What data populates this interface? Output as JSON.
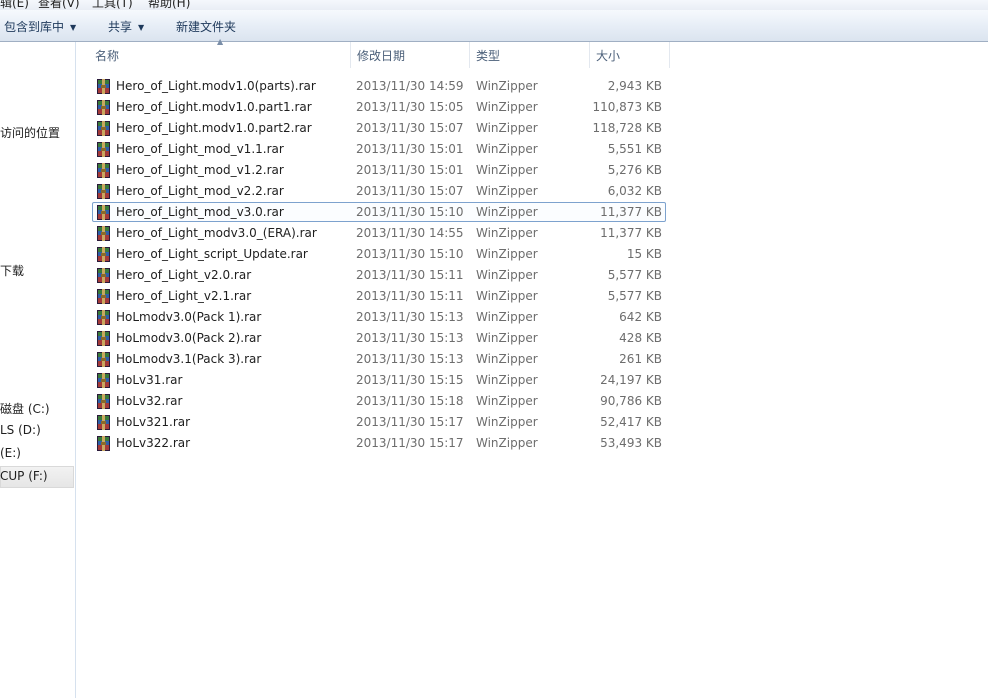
{
  "menubar": {
    "items": [
      "辑(E)",
      "查看(V)",
      "工具(T)",
      "帮助(H)"
    ]
  },
  "toolbar": {
    "include_library": "包含到库中",
    "share": "共享",
    "new_folder": "新建文件夹"
  },
  "navpane": {
    "recent_places": "访问的位置",
    "downloads": "下载",
    "drive_c": "磁盘 (C:)",
    "drive_d": "LS (D:)",
    "drive_e": "(E:)",
    "drive_f": "CUP (F:)"
  },
  "columns": {
    "name": "名称",
    "date": "修改日期",
    "type": "类型",
    "size": "大小"
  },
  "files": [
    {
      "name": "Hero_of_Light.modv1.0(parts).rar",
      "date": "2013/11/30 14:59",
      "type": "WinZipper",
      "size": "2,943 KB"
    },
    {
      "name": "Hero_of_Light.modv1.0.part1.rar",
      "date": "2013/11/30 15:05",
      "type": "WinZipper",
      "size": "110,873 KB"
    },
    {
      "name": "Hero_of_Light.modv1.0.part2.rar",
      "date": "2013/11/30 15:07",
      "type": "WinZipper",
      "size": "118,728 KB"
    },
    {
      "name": "Hero_of_Light_mod_v1.1.rar",
      "date": "2013/11/30 15:01",
      "type": "WinZipper",
      "size": "5,551 KB"
    },
    {
      "name": "Hero_of_Light_mod_v1.2.rar",
      "date": "2013/11/30 15:01",
      "type": "WinZipper",
      "size": "5,276 KB"
    },
    {
      "name": "Hero_of_Light_mod_v2.2.rar",
      "date": "2013/11/30 15:07",
      "type": "WinZipper",
      "size": "6,032 KB"
    },
    {
      "name": "Hero_of_Light_mod_v3.0.rar",
      "date": "2013/11/30 15:10",
      "type": "WinZipper",
      "size": "11,377 KB",
      "selected": true
    },
    {
      "name": "Hero_of_Light_modv3.0_(ERA).rar",
      "date": "2013/11/30 14:55",
      "type": "WinZipper",
      "size": "11,377 KB"
    },
    {
      "name": "Hero_of_Light_script_Update.rar",
      "date": "2013/11/30 15:10",
      "type": "WinZipper",
      "size": "15 KB"
    },
    {
      "name": "Hero_of_Light_v2.0.rar",
      "date": "2013/11/30 15:11",
      "type": "WinZipper",
      "size": "5,577 KB"
    },
    {
      "name": "Hero_of_Light_v2.1.rar",
      "date": "2013/11/30 15:11",
      "type": "WinZipper",
      "size": "5,577 KB"
    },
    {
      "name": "HoLmodv3.0(Pack 1).rar",
      "date": "2013/11/30 15:13",
      "type": "WinZipper",
      "size": "642 KB"
    },
    {
      "name": "HoLmodv3.0(Pack 2).rar",
      "date": "2013/11/30 15:13",
      "type": "WinZipper",
      "size": "428 KB"
    },
    {
      "name": "HoLmodv3.1(Pack 3).rar",
      "date": "2013/11/30 15:13",
      "type": "WinZipper",
      "size": "261 KB"
    },
    {
      "name": "HoLv31.rar",
      "date": "2013/11/30 15:15",
      "type": "WinZipper",
      "size": "24,197 KB"
    },
    {
      "name": "HoLv32.rar",
      "date": "2013/11/30 15:18",
      "type": "WinZipper",
      "size": "90,786 KB"
    },
    {
      "name": "HoLv321.rar",
      "date": "2013/11/30 15:17",
      "type": "WinZipper",
      "size": "52,417 KB"
    },
    {
      "name": "HoLv322.rar",
      "date": "2013/11/30 15:17",
      "type": "WinZipper",
      "size": "53,493 KB"
    }
  ],
  "file_icon": "winrar-archive-icon"
}
